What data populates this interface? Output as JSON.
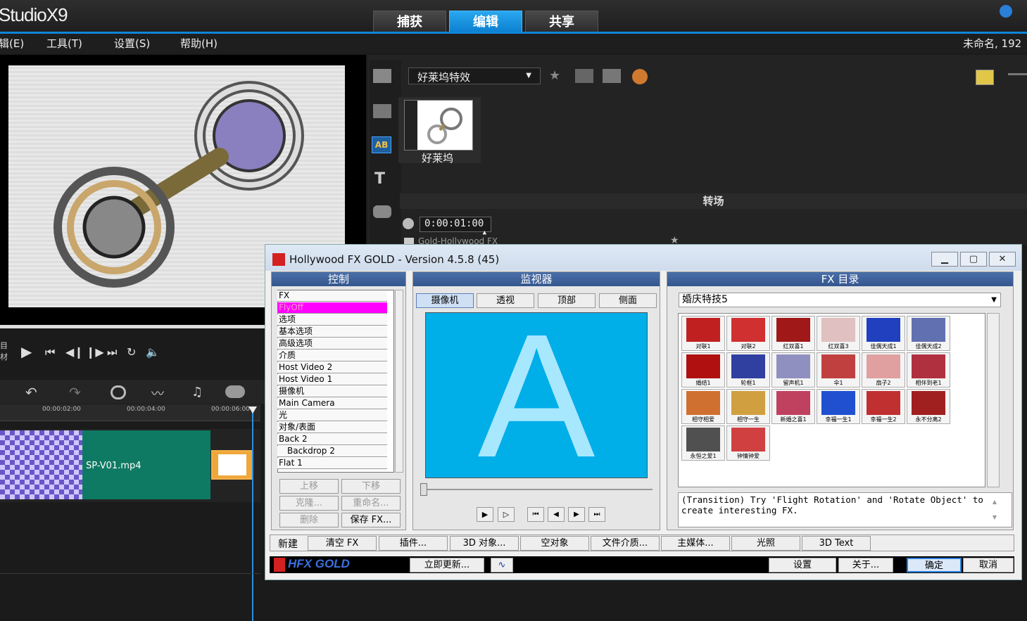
{
  "app": {
    "logo": "StudioX9",
    "tabs": [
      {
        "label": "捕获"
      },
      {
        "label": "编辑"
      },
      {
        "label": "共享"
      }
    ],
    "project_title": "未命名, 192"
  },
  "menu": [
    {
      "label": "辑(E)"
    },
    {
      "label": "工具(T)"
    },
    {
      "label": "设置(S)"
    },
    {
      "label": "帮助(H)"
    }
  ],
  "player": {
    "side_labels": [
      "目",
      "材"
    ]
  },
  "timeline": {
    "ticks": [
      "00:00:02:00",
      "00:00:04:00",
      "00:00:06:00"
    ],
    "clip_name": "SP-V01.mp4"
  },
  "library": {
    "dropdown": "好莱坞特效",
    "thumb_label": "好莱坞",
    "transition_header": "转场",
    "duration": "0:00:01:00",
    "filter_checkbox": "Gold-Hollywood FX"
  },
  "hfx": {
    "title": "Hollywood FX GOLD - Version 4.5.8 (45)",
    "control": {
      "header": "控制",
      "rows": [
        "FX",
        "FlyOff",
        "选项",
        "基本选项",
        "高级选项",
        "介质",
        "Host Video 2",
        "Host Video 1",
        "摄像机",
        "Main Camera",
        "光",
        "对象/表面",
        "Back 2",
        "Backdrop 2",
        "Flat 1"
      ],
      "buttons": [
        {
          "label": "上移"
        },
        {
          "label": "下移"
        },
        {
          "label": "克隆..."
        },
        {
          "label": "重命名..."
        },
        {
          "label": "删除"
        },
        {
          "label": "保存 FX..."
        }
      ]
    },
    "monitor": {
      "header": "监视器",
      "tabs": [
        {
          "label": "摄像机"
        },
        {
          "label": "透视"
        },
        {
          "label": "顶部"
        },
        {
          "label": "侧面"
        }
      ],
      "preview_letter": "A"
    },
    "catalog": {
      "header": "FX 目录",
      "dropdown": "婚庆特技5",
      "items": [
        {
          "label": "对联1"
        },
        {
          "label": "对联2"
        },
        {
          "label": "红双喜1"
        },
        {
          "label": "红双喜3"
        },
        {
          "label": "佳偶天成1"
        },
        {
          "label": "佳偶天成2"
        },
        {
          "label": "婚结1"
        },
        {
          "label": "轮框1"
        },
        {
          "label": "留声机1"
        },
        {
          "label": "伞1"
        },
        {
          "label": "扇子2"
        },
        {
          "label": "相伴到老1"
        },
        {
          "label": "相守相爱"
        },
        {
          "label": "相守一生"
        },
        {
          "label": "新婚之喜1"
        },
        {
          "label": "幸福一生1"
        },
        {
          "label": "幸福一生2"
        },
        {
          "label": "永不分离2"
        },
        {
          "label": "永恒之爱1"
        },
        {
          "label": "钟情钟爱"
        }
      ],
      "description": "(Transition) Try 'Flight Rotation' and 'Rotate Object' to create interesting FX."
    },
    "bottom": {
      "new_label": "新建",
      "buttons": [
        {
          "label": "清空 FX"
        },
        {
          "label": "插件..."
        },
        {
          "label": "3D 对象..."
        },
        {
          "label": "空对象"
        },
        {
          "label": "文件介质..."
        },
        {
          "label": "主媒体..."
        },
        {
          "label": "光照"
        },
        {
          "label": "3D Text"
        }
      ]
    },
    "footer": {
      "brand": "HFX GOLD",
      "update": "立即更新...",
      "settings": "设置",
      "about": "关于...",
      "ok": "确定",
      "cancel": "取消"
    }
  },
  "colors": {
    "accent": "#0f86d8",
    "monitor_bg": "#00aee8",
    "highlight": "#ff00ff"
  }
}
